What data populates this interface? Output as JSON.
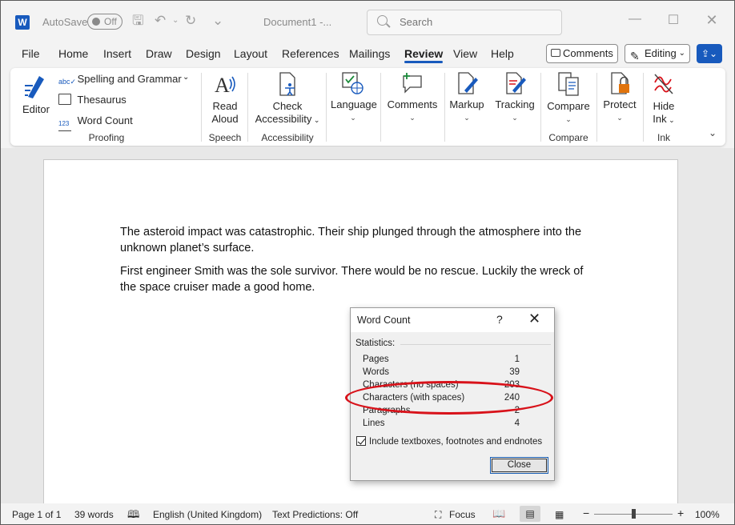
{
  "titlebar": {
    "autosave_label": "AutoSave",
    "autosave_state": "Off",
    "document_name": "Document1 -...",
    "search_placeholder": "Search"
  },
  "menu": {
    "tabs": [
      "File",
      "Home",
      "Insert",
      "Draw",
      "Design",
      "Layout",
      "References",
      "Mailings",
      "Review",
      "View",
      "Help"
    ],
    "active_tab": "Review",
    "comments_label": "Comments",
    "editing_label": "Editing"
  },
  "ribbon": {
    "editor": "Editor",
    "spelling": "Spelling and Grammar",
    "thesaurus": "Thesaurus",
    "word_count": "Word Count",
    "proofing": "Proofing",
    "read_aloud_1": "Read",
    "read_aloud_2": "Aloud",
    "speech": "Speech",
    "check_acc_1": "Check",
    "check_acc_2": "Accessibility",
    "accessibility": "Accessibility",
    "language": "Language",
    "comments": "Comments",
    "markup": "Markup",
    "tracking": "Tracking",
    "compare": "Compare",
    "compare_group": "Compare",
    "protect": "Protect",
    "hide_ink_1": "Hide",
    "hide_ink_2": "Ink",
    "ink_group": "Ink"
  },
  "document": {
    "paragraphs": [
      "The asteroid impact was catastrophic. Their ship plunged through the atmosphere into the unknown planet’s surface.",
      "First engineer Smith was the sole survivor. There would be no rescue. Luckily the wreck of the space cruiser made a good home."
    ]
  },
  "dialog": {
    "title": "Word Count",
    "help": "?",
    "statistics_label": "Statistics:",
    "stats": [
      {
        "label": "Pages",
        "value": "1"
      },
      {
        "label": "Words",
        "value": "39"
      },
      {
        "label": "Characters (no spaces)",
        "value": "203"
      },
      {
        "label": "Characters (with spaces)",
        "value": "240"
      },
      {
        "label": "Paragraphs",
        "value": "2"
      },
      {
        "label": "Lines",
        "value": "4"
      }
    ],
    "checkbox_label": "Include textboxes, footnotes and endnotes",
    "close_label": "Close"
  },
  "statusbar": {
    "page": "Page 1 of 1",
    "words": "39 words",
    "language": "English (United Kingdom)",
    "predictions": "Text Predictions: Off",
    "focus": "Focus",
    "zoom": "100%"
  },
  "colors": {
    "accent": "#185abd",
    "highlight_ellipse": "#d8121a"
  }
}
